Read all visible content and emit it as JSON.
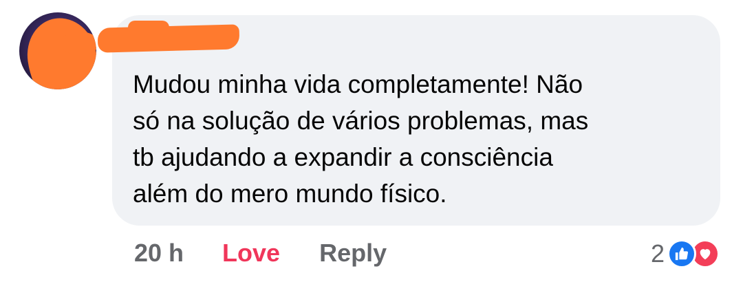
{
  "comment": {
    "text": "Mudou minha vida completamente! Não\nsó na solução de vários problemas, mas\ntb ajudando a expandir a consciência\nalém do mero mundo físico."
  },
  "actions": {
    "time": "20 h",
    "love": "Love",
    "reply": "Reply"
  },
  "reactions": {
    "count": "2",
    "icons": [
      "like-icon",
      "heart-icon"
    ]
  },
  "colors": {
    "bubble": "#f0f2f5",
    "love": "#f0365a",
    "like": "#1877f2",
    "heart": "#f33e58",
    "redaction": "#ff7a2e"
  }
}
